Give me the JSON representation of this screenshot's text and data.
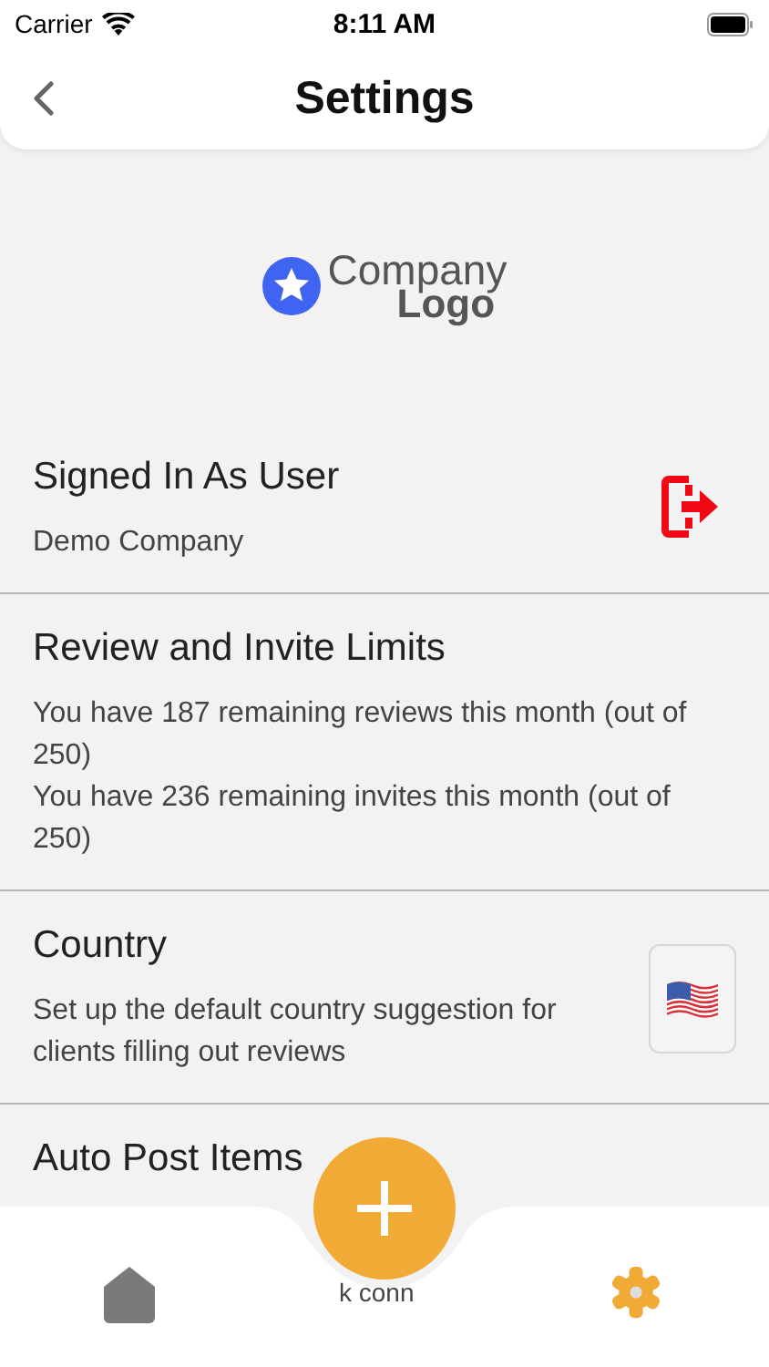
{
  "status_bar": {
    "carrier": "Carrier",
    "time": "8:11 AM"
  },
  "nav": {
    "title": "Settings"
  },
  "logo": {
    "line1": "Company",
    "line2": "Logo"
  },
  "sections": [
    {
      "kind": "signout",
      "title": "Signed In As User",
      "lines": [
        "Demo Company"
      ]
    },
    {
      "kind": "text",
      "title": "Review and Invite Limits",
      "lines": [
        "You have 187 remaining reviews this month (out of 250)",
        "You have 236 remaining invites this month (out of 250)"
      ]
    },
    {
      "kind": "flag",
      "title": "Country",
      "lines": [
        "Set up the default country suggestion for clients filling out reviews"
      ]
    },
    {
      "kind": "text",
      "title": "Auto Post Items"
    }
  ],
  "peek_text": "k conn",
  "tab_bar": {
    "items": [
      {
        "kind": "home",
        "selected": false
      },
      {
        "kind": "settings",
        "selected": true
      }
    ]
  }
}
